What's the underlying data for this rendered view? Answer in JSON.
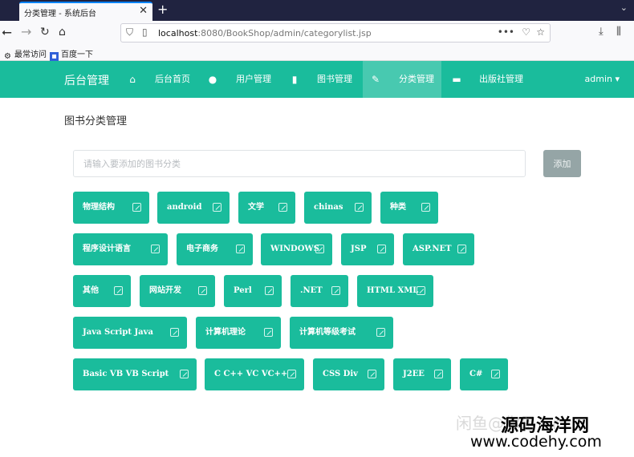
{
  "browser": {
    "tab_title": "分类管理 - 系统后台",
    "tab_close": "✕",
    "new_tab": "+",
    "url_host": "localhost",
    "url_path": ":8080/BookShop/admin/categorylist.jsp",
    "bookmarks": [
      {
        "label": "最常访问",
        "icon": "gear-icon"
      },
      {
        "label": "百度一下",
        "icon": "baidu-icon"
      }
    ]
  },
  "app": {
    "brand": "后台管理",
    "menu": [
      {
        "label": "后台首页",
        "icon": "home-icon",
        "active": false
      },
      {
        "label": "用户管理",
        "icon": "user-icon",
        "active": false
      },
      {
        "label": "图书管理",
        "icon": "book-icon",
        "active": false
      },
      {
        "label": "分类管理",
        "icon": "pin-icon",
        "active": true
      },
      {
        "label": "出版社管理",
        "icon": "briefcase-icon",
        "active": false
      }
    ],
    "user": "admin ▾",
    "accent": "#1abc9c"
  },
  "page": {
    "title": "图书分类管理",
    "input_placeholder": "请输入要添加的图书分类",
    "input_value": "",
    "add_label": "添加",
    "categories": [
      "物理结构",
      "android",
      "文学",
      "chinas",
      "种类",
      "程序设计语言",
      "电子商务",
      "WINDOWS",
      "JSP",
      "ASP.NET",
      "其他",
      "网站开发",
      "Perl",
      ".NET",
      "HTML XML",
      "Java Script Java",
      "计算机理论",
      "计算机等级考试",
      "Basic VB VB Script",
      "C C++ VC VC++",
      "CSS Div",
      "J2EE",
      "C#"
    ]
  },
  "watermark": {
    "line1": "闲鱼@你是一r",
    "line2": "源码海洋网",
    "line3": "www.codehy.com"
  }
}
